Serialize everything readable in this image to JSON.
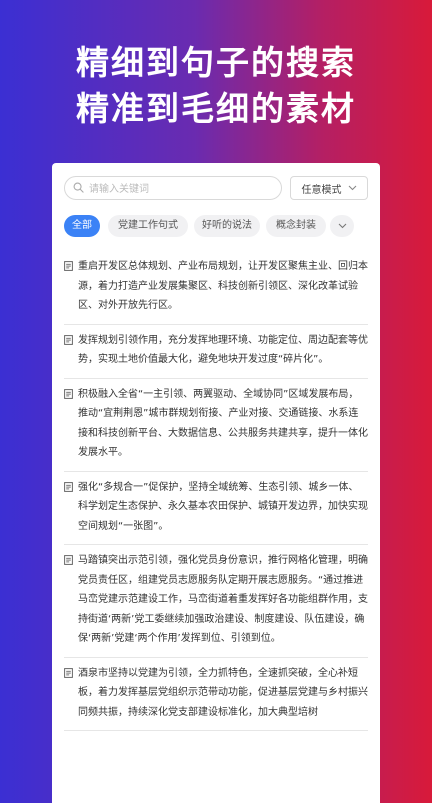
{
  "promo": {
    "line1": "精细到句子的搜索",
    "line2": "精准到毛细的素材"
  },
  "colors": {
    "bg_start": "#3b2fd3",
    "bg_end": "#d81a3a",
    "accent": "#3b82f6"
  },
  "search": {
    "placeholder": "请输入关键词",
    "icon": "search-icon"
  },
  "mode": {
    "label": "任意模式",
    "icon": "chevron-down-icon"
  },
  "tabs": [
    {
      "label": "全部",
      "active": true
    },
    {
      "label": "党建工作句式",
      "active": false
    },
    {
      "label": "好听的说法",
      "active": false
    },
    {
      "label": "概念封装",
      "active": false
    }
  ],
  "results": [
    {
      "text": "重启开发区总体规划、产业布局规划，让开发区聚焦主业、回归本源，着力打造产业发展集聚区、科技创新引领区、深化改革试验区、对外开放先行区。"
    },
    {
      "text": "发挥规划引领作用，充分发挥地理环境、功能定位、周边配套等优势，实现土地价值最大化，避免地块开发过度“碎片化”。"
    },
    {
      "text": "积极融入全省“一主引领、两翼驱动、全域协同”区域发展布局，推动“宜荆荆恩”城市群规划衔接、产业对接、交通链接、水系连接和科技创新平台、大数据信息、公共服务共建共享，提升一体化发展水平。"
    },
    {
      "text": "强化“多规合一”促保护，坚持全域统筹、生态引领、城乡一体、科学划定生态保护、永久基本农田保护、城镇开发边界，加快实现空间规划“一张图”。"
    },
    {
      "text": "马踏镇突出示范引领，强化党员身份意识，推行网格化管理，明确党员责任区，组建党员志愿服务队定期开展志愿服务。“通过推进马峦党建示范建设工作，马峦街道着重发挥好各功能组群作用，支持街道‘两新’党工委继续加强政治建设、制度建设、队伍建设，确保‘两新’党建‘两个作用’发挥到位、引领到位。"
    },
    {
      "text": "酒泉市坚持以党建为引领，全力抓特色，全速抓突破，全心补短板，着力发挥基层党组织示范带动功能，促进基层党建与乡村振兴同频共振，持续深化党支部建设标准化，加大典型培树"
    }
  ]
}
